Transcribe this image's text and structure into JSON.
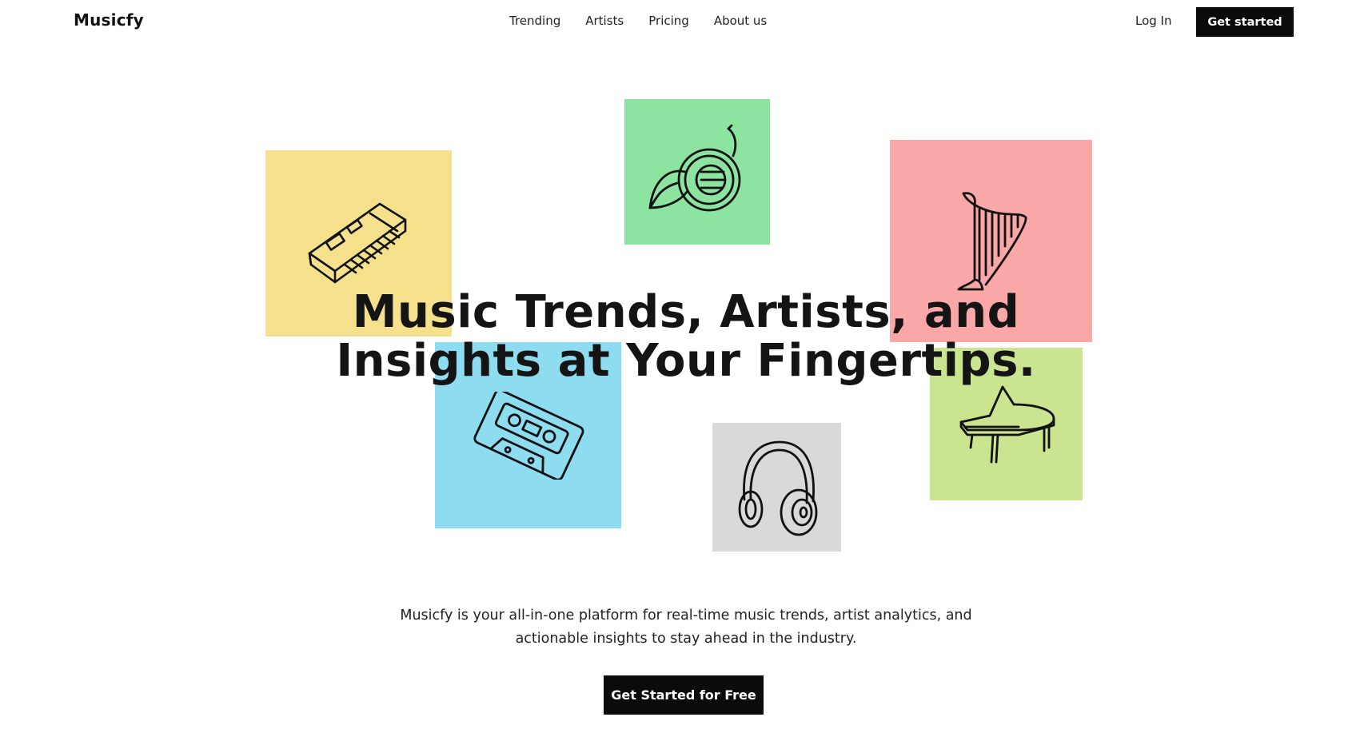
{
  "nav": {
    "logo": "Musicfy",
    "links": [
      "Trending",
      "Artists",
      "Pricing",
      "About us"
    ],
    "login": "Log In",
    "cta": "Get started"
  },
  "hero": {
    "title_line1": "Music Trends, Artists, and",
    "title_line2": "Insights at Your Fingertips.",
    "subtitle_line1": "Musicfy is your all-in-one platform for real-time music trends, artist analytics, and",
    "subtitle_line2": "actionable insights to stay ahead in the industry.",
    "cta": "Get Started for Free"
  },
  "tiles": [
    {
      "icon": "keyboard-synth-icon",
      "color": "#f5e18c"
    },
    {
      "icon": "french-horn-icon",
      "color": "#8ce4a0"
    },
    {
      "icon": "harp-icon",
      "color": "#f9a7a7"
    },
    {
      "icon": "cassette-tape-icon",
      "color": "#8ddcf0"
    },
    {
      "icon": "headphones-icon",
      "color": "#d9d9d9"
    },
    {
      "icon": "grand-piano-icon",
      "color": "#cbe48f"
    }
  ],
  "colors": {
    "button_bg": "#0b0b0b",
    "button_text": "#ffffff",
    "text": "#111111"
  }
}
